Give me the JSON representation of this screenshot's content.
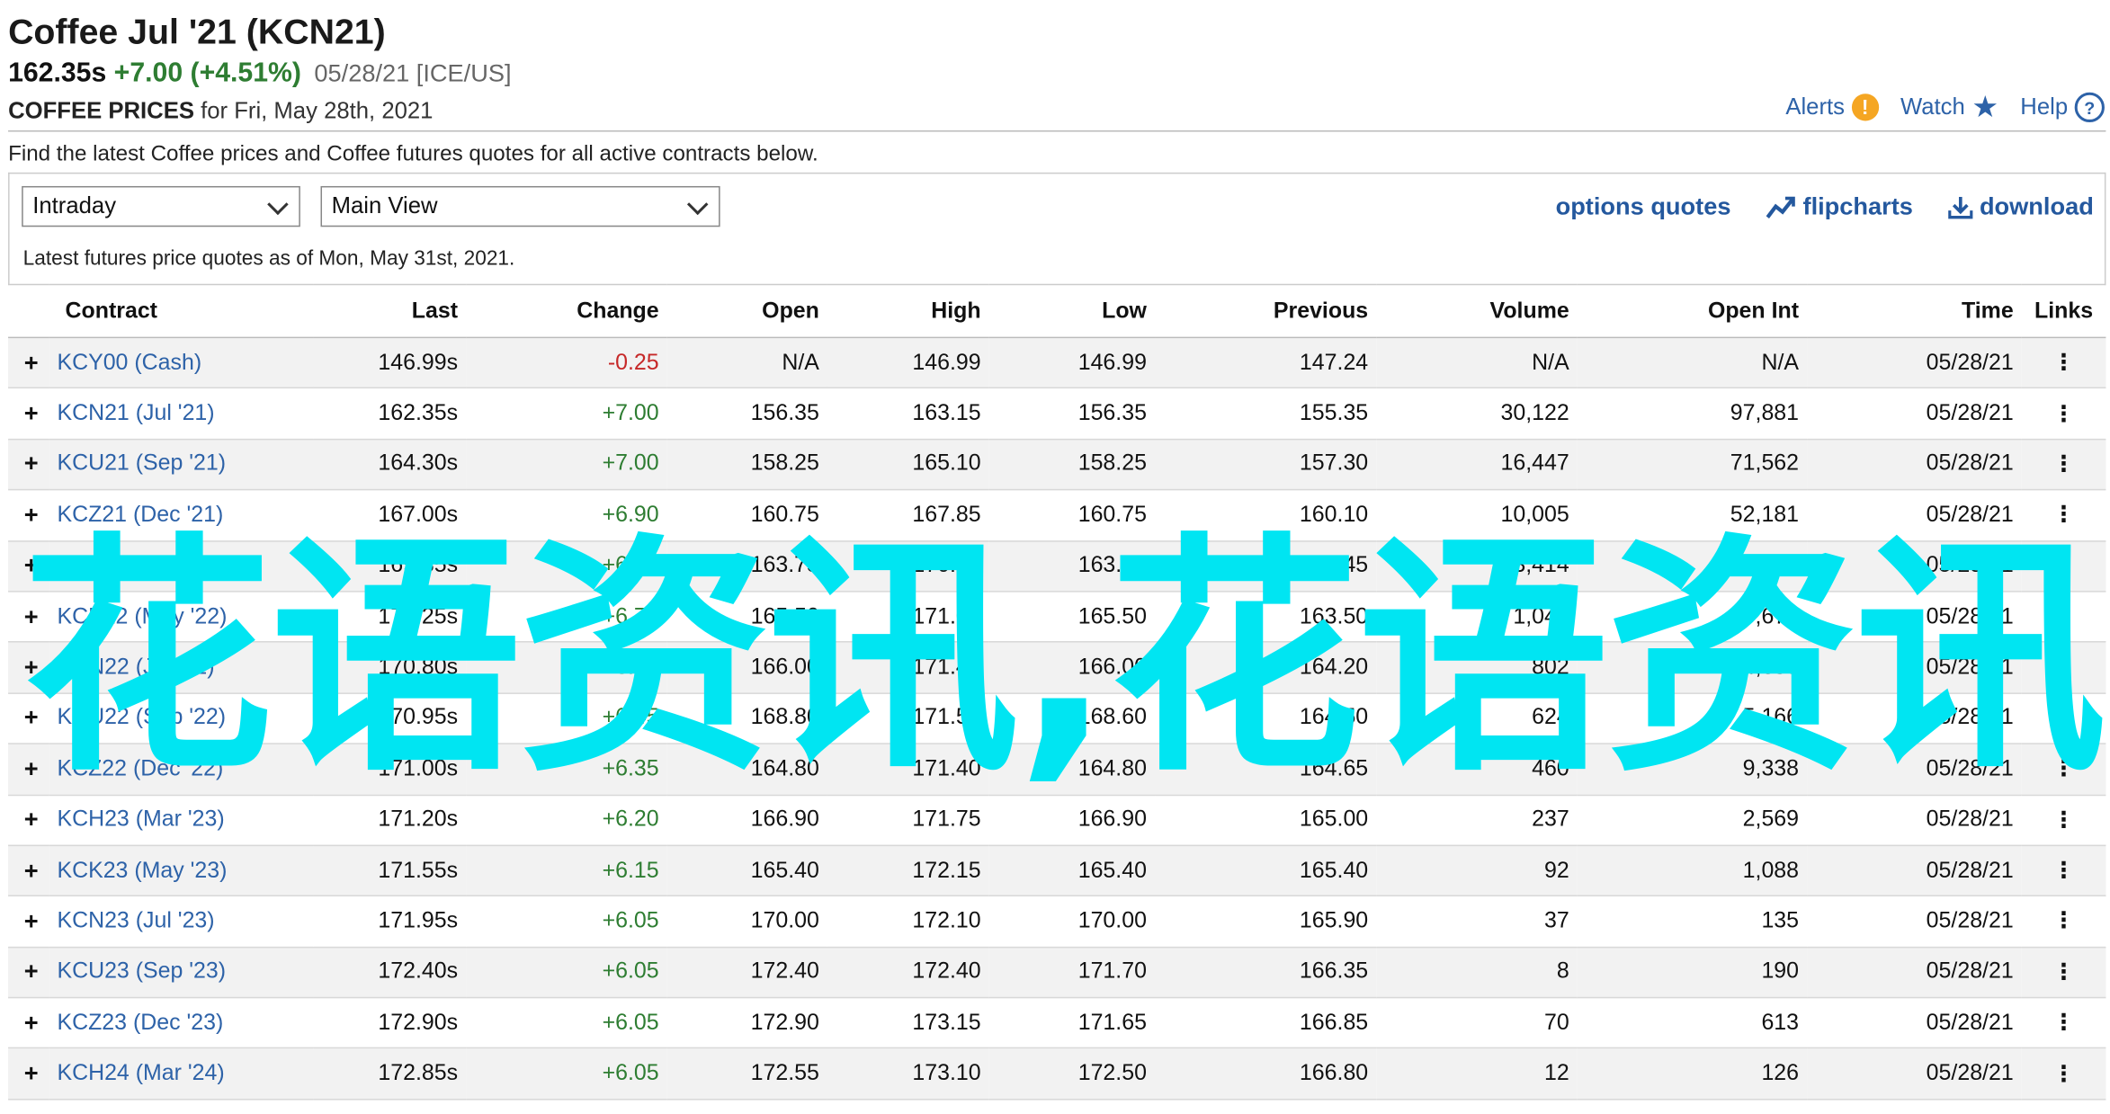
{
  "header": {
    "title": "Coffee Jul '21 (KCN21)",
    "last": "162.35s",
    "change": "+7.00 (+4.51%)",
    "date_exchange": "05/28/21 [ICE/US]",
    "subtitle_bold": "COFFEE PRICES",
    "subtitle_rest": " for Fri, May 28th, 2021"
  },
  "toplinks": {
    "alerts": "Alerts",
    "watch": "Watch",
    "help": "Help",
    "alert_glyph": "!",
    "help_glyph": "?"
  },
  "description": "Find the latest Coffee prices and Coffee futures quotes for all active contracts below.",
  "controls": {
    "period_select": "Intraday",
    "view_select": "Main View",
    "options_quotes": "options quotes",
    "flipcharts": "flipcharts",
    "download": "download",
    "as_of": "Latest futures price quotes as of Mon, May 31st, 2021."
  },
  "table": {
    "headers": [
      "Contract",
      "Last",
      "Change",
      "Open",
      "High",
      "Low",
      "Previous",
      "Volume",
      "Open Int",
      "Time",
      "Links"
    ],
    "rows": [
      [
        "KCY00 (Cash)",
        "146.99s",
        "-0.25",
        "N/A",
        "146.99",
        "146.99",
        "147.24",
        "N/A",
        "N/A",
        "05/28/21"
      ],
      [
        "KCN21 (Jul '21)",
        "162.35s",
        "+7.00",
        "156.35",
        "163.15",
        "156.35",
        "155.35",
        "30,122",
        "97,881",
        "05/28/21"
      ],
      [
        "KCU21 (Sep '21)",
        "164.30s",
        "+7.00",
        "158.25",
        "165.10",
        "158.25",
        "157.30",
        "16,447",
        "71,562",
        "05/28/21"
      ],
      [
        "KCZ21 (Dec '21)",
        "167.00s",
        "+6.90",
        "160.75",
        "167.85",
        "160.75",
        "160.10",
        "10,005",
        "52,181",
        "05/28/21"
      ],
      [
        "KCH22 (Mar '22)",
        "169.35s",
        "+6.90",
        "163.75",
        "170.15",
        "163.75",
        "162.45",
        "3,414",
        "30,196",
        "05/28/21"
      ],
      [
        "KCK22 (May '22)",
        "170.25s",
        "+6.75",
        "165.50",
        "171.00",
        "165.50",
        "163.50",
        "1,042",
        "9,673",
        "05/28/21"
      ],
      [
        "KCN22 (Jul '22)",
        "170.80s",
        "+6.60",
        "166.00",
        "171.40",
        "166.00",
        "164.20",
        "802",
        "4,659",
        "05/28/21"
      ],
      [
        "KCU22 (Sep '22)",
        "170.95s",
        "+6.45",
        "168.80",
        "171.50",
        "168.60",
        "164.50",
        "624",
        "5,166",
        "05/28/21"
      ],
      [
        "KCZ22 (Dec '22)",
        "171.00s",
        "+6.35",
        "164.80",
        "171.40",
        "164.80",
        "164.65",
        "460",
        "9,338",
        "05/28/21"
      ],
      [
        "KCH23 (Mar '23)",
        "171.20s",
        "+6.20",
        "166.90",
        "171.75",
        "166.90",
        "165.00",
        "237",
        "2,569",
        "05/28/21"
      ],
      [
        "KCK23 (May '23)",
        "171.55s",
        "+6.15",
        "165.40",
        "172.15",
        "165.40",
        "165.40",
        "92",
        "1,088",
        "05/28/21"
      ],
      [
        "KCN23 (Jul '23)",
        "171.95s",
        "+6.05",
        "170.00",
        "172.10",
        "170.00",
        "165.90",
        "37",
        "135",
        "05/28/21"
      ],
      [
        "KCU23 (Sep '23)",
        "172.40s",
        "+6.05",
        "172.40",
        "172.40",
        "171.70",
        "166.35",
        "8",
        "190",
        "05/28/21"
      ],
      [
        "KCZ23 (Dec '23)",
        "172.90s",
        "+6.05",
        "172.90",
        "173.15",
        "171.65",
        "166.85",
        "70",
        "613",
        "05/28/21"
      ],
      [
        "KCH24 (Mar '24)",
        "172.85s",
        "+6.05",
        "172.55",
        "173.10",
        "172.50",
        "166.80",
        "12",
        "126",
        "05/28/21"
      ]
    ]
  },
  "watermark": "花语资讯,花语资讯",
  "colors": {
    "link": "#2d62a8",
    "positive": "#2e7d32",
    "negative": "#c62828",
    "watermark": "#00e5f2",
    "alert": "#f5a623"
  }
}
